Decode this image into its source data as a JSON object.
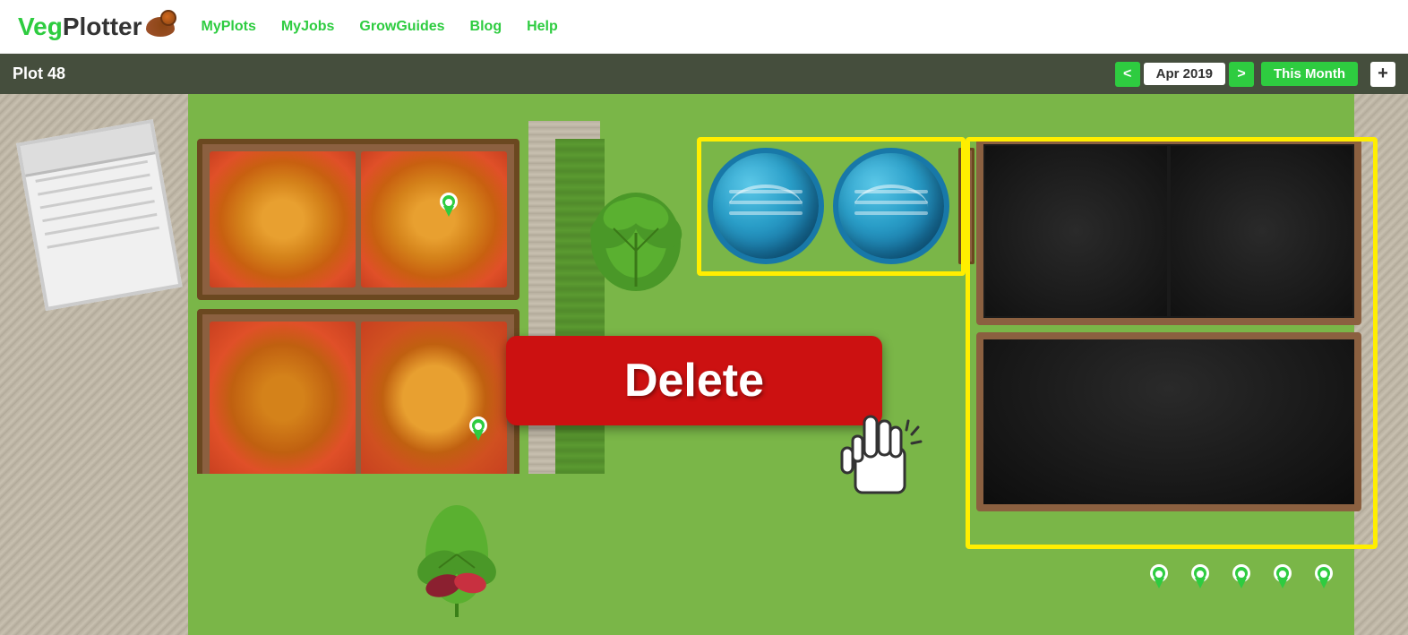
{
  "header": {
    "logo_veg": "VegPlotter",
    "logo_veg_part": "Veg",
    "logo_plotter_part": "Plotter",
    "nav": {
      "my_plots": "MyPlots",
      "my_jobs": "MyJobs",
      "grow_guides": "GrowGuides",
      "blog": "Blog",
      "help": "Help"
    }
  },
  "toolbar": {
    "plot_title": "Plot 48",
    "prev_label": "<",
    "next_label": ">",
    "date_display": "Apr 2019",
    "this_month_label": "This Month",
    "plus_label": "+"
  },
  "delete_button": {
    "label": "Delete"
  },
  "colors": {
    "green_accent": "#2ecc40",
    "dark_bg": "#3a3a3a",
    "garden_green": "#7ab648",
    "wood_brown": "#8B6040",
    "water_blue": "#2a9ec8",
    "delete_red": "#cc1111",
    "yellow_select": "#ffee00"
  }
}
